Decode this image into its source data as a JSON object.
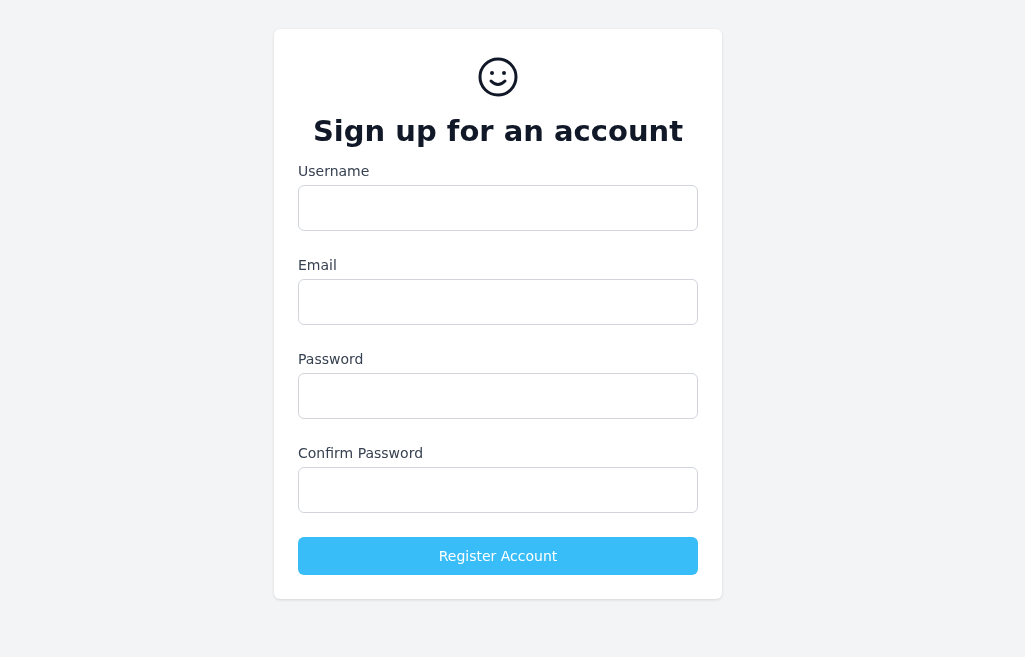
{
  "title": "Sign up for an account",
  "fields": [
    {
      "label": "Username"
    },
    {
      "label": "Email"
    },
    {
      "label": "Password"
    },
    {
      "label": "Confirm Password"
    }
  ],
  "submit": "Register Account"
}
